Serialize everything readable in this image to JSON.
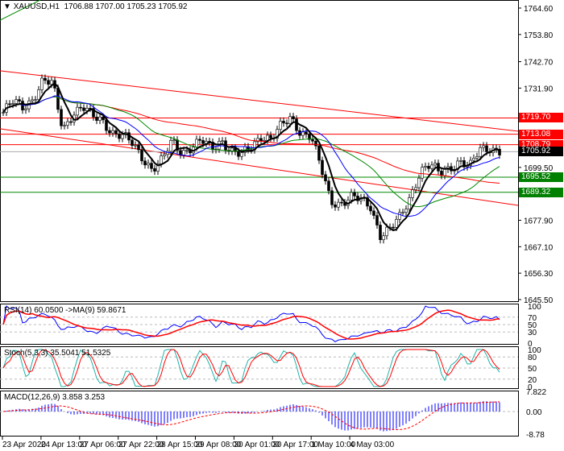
{
  "header": {
    "symbol": "XAUUSD,H1",
    "open": "1706.88",
    "high": "1707.00",
    "low": "1705.23",
    "close": "1705.92"
  },
  "price_tags": [
    {
      "label": "1719.70",
      "color": "#ff0000"
    },
    {
      "label": "1713.08",
      "color": "#ff0000"
    },
    {
      "label": "1708.79",
      "color": "#ff0000"
    },
    {
      "label": "1705.92",
      "color": "#000000"
    },
    {
      "label": "1695.52",
      "color": "#008000"
    },
    {
      "label": "1689.32",
      "color": "#008000"
    }
  ],
  "indicators": {
    "rsi": "RSI(14) 60.0500  ->MA(9) 59.8671",
    "stoch": "Stoch(5,3,3) 35.5041 51.5325",
    "macd": "MACD(12,26,9) 3.858 3.253"
  },
  "chart_data": {
    "type": "candlestick",
    "title": "XAUUSD,H1",
    "ylim": [
      1645.5,
      1764.6
    ],
    "y_ticks": [
      "1764.60",
      "1753.80",
      "1742.70",
      "1731.90",
      "1699.50",
      "1677.90",
      "1667.10",
      "1656.30",
      "1645.50"
    ],
    "x_ticks": [
      "23 Apr 2020",
      "24 Apr 13:00",
      "27 Apr 06:00",
      "27 Apr 22:00",
      "28 Apr 15:00",
      "29 Apr 08:00",
      "30 Apr 01:00",
      "30 Apr 17:00",
      "1 May 10:00",
      "4 May 03:00"
    ],
    "close_keypoints": [
      1722,
      1726,
      1724,
      1728,
      1735,
      1733,
      1715,
      1722,
      1724,
      1720,
      1719,
      1714,
      1712,
      1709,
      1704,
      1699,
      1702,
      1710,
      1706,
      1708,
      1710,
      1707,
      1711,
      1706,
      1704,
      1708,
      1713,
      1711,
      1716,
      1720,
      1714,
      1712,
      1699,
      1686,
      1685,
      1687,
      1686,
      1684,
      1672,
      1674,
      1679,
      1688,
      1698,
      1700,
      1697,
      1700,
      1702,
      1699,
      1707,
      1708,
      1706
    ],
    "levels": [
      1719.7,
      1713.08,
      1708.79,
      1705.92,
      1695.52,
      1689.32
    ],
    "rsi": {
      "levels": [
        30,
        50,
        70
      ],
      "ticks": [
        "100",
        "70",
        "50",
        "30",
        "0"
      ]
    },
    "stoch": {
      "levels": [
        20,
        50,
        80
      ],
      "ticks": [
        "100",
        "80",
        "50",
        "20",
        "0"
      ]
    },
    "macd": {
      "ticks": [
        "7.822",
        "0.00",
        "-8.78"
      ]
    }
  }
}
